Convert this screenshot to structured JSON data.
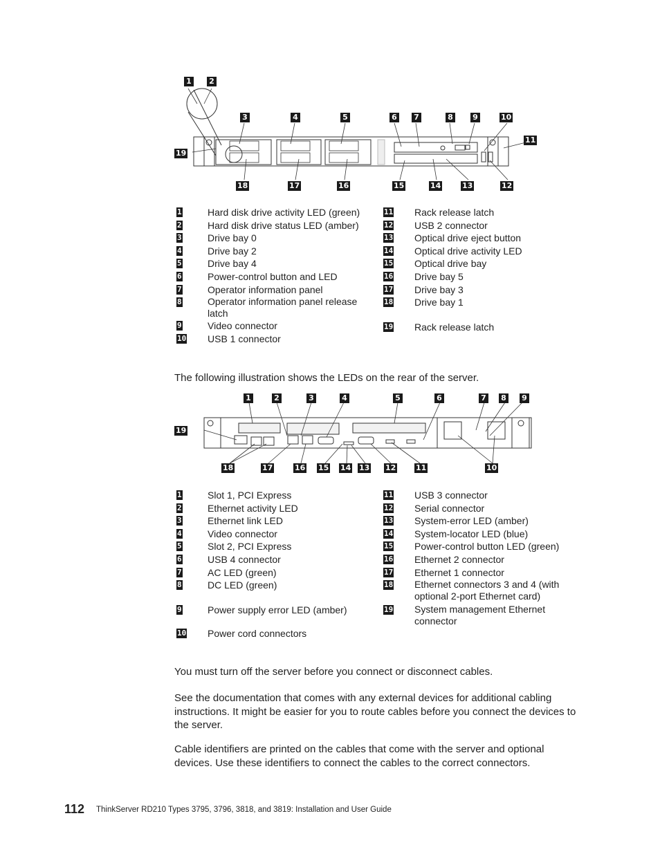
{
  "front_view": {
    "callouts_top": [
      "1",
      "2",
      "3",
      "4",
      "5",
      "6",
      "7",
      "8",
      "9",
      "10",
      "11",
      "19"
    ],
    "callouts_bottom": [
      "18",
      "17",
      "16",
      "15",
      "14",
      "13",
      "12"
    ],
    "legend_left": [
      {
        "num": "1",
        "text": "Hard disk drive activity LED (green)"
      },
      {
        "num": "2",
        "text": "Hard disk drive status LED (amber)"
      },
      {
        "num": "3",
        "text": "Drive bay 0"
      },
      {
        "num": "4",
        "text": "Drive bay 2"
      },
      {
        "num": "5",
        "text": "Drive bay 4"
      },
      {
        "num": "6",
        "text": "Power-control button and LED"
      },
      {
        "num": "7",
        "text": "Operator information panel"
      },
      {
        "num": "8",
        "text": "Operator information panel release latch"
      },
      {
        "num": "9",
        "text": "Video connector"
      },
      {
        "num": "10",
        "text": "USB 1 connector"
      }
    ],
    "legend_right": [
      {
        "num": "11",
        "text": "Rack release latch"
      },
      {
        "num": "12",
        "text": "USB 2 connector"
      },
      {
        "num": "13",
        "text": "Optical drive eject button"
      },
      {
        "num": "14",
        "text": "Optical drive activity LED"
      },
      {
        "num": "15",
        "text": "Optical drive bay"
      },
      {
        "num": "16",
        "text": "Drive bay 5"
      },
      {
        "num": "17",
        "text": "Drive bay 3"
      },
      {
        "num": "18",
        "text": "Drive bay 1"
      },
      {
        "num": "19",
        "text": "Rack release latch"
      }
    ]
  },
  "rear_intro": "The following illustration shows the LEDs on the rear of the server.",
  "rear_view": {
    "legend_left": [
      {
        "num": "1",
        "text": "Slot 1, PCI Express"
      },
      {
        "num": "2",
        "text": "Ethernet activity LED"
      },
      {
        "num": "3",
        "text": "Ethernet link LED"
      },
      {
        "num": "4",
        "text": "Video connector"
      },
      {
        "num": "5",
        "text": "Slot 2, PCI Express"
      },
      {
        "num": "6",
        "text": "USB 4 connector"
      },
      {
        "num": "7",
        "text": "AC LED (green)"
      },
      {
        "num": "8",
        "text": "DC LED (green)"
      },
      {
        "num": "9",
        "text": "Power supply error LED (amber)"
      },
      {
        "num": "10",
        "text": "Power cord connectors"
      }
    ],
    "legend_right": [
      {
        "num": "11",
        "text": "USB 3 connector"
      },
      {
        "num": "12",
        "text": "Serial connector"
      },
      {
        "num": "13",
        "text": "System-error LED (amber)"
      },
      {
        "num": "14",
        "text": "System-locator LED (blue)"
      },
      {
        "num": "15",
        "text": "Power-control button LED (green)"
      },
      {
        "num": "16",
        "text": "Ethernet 2 connector"
      },
      {
        "num": "17",
        "text": "Ethernet 1 connector"
      },
      {
        "num": "18",
        "text": "Ethernet connectors 3 and 4 (with optional 2-port Ethernet card)"
      },
      {
        "num": "19",
        "text": "System management Ethernet connector"
      }
    ]
  },
  "paragraphs": [
    "You must turn off the server before you connect or disconnect cables.",
    "See the documentation that comes with any external devices for additional cabling instructions. It might be easier for you to route cables before you connect the devices to the server.",
    "Cable identifiers are printed on the cables that come with the server and optional devices. Use these identifiers to connect the cables to the correct connectors."
  ],
  "footer": {
    "page_number": "112",
    "title": "ThinkServer RD210 Types 3795, 3796, 3818, and 3819:  Installation and User Guide"
  }
}
